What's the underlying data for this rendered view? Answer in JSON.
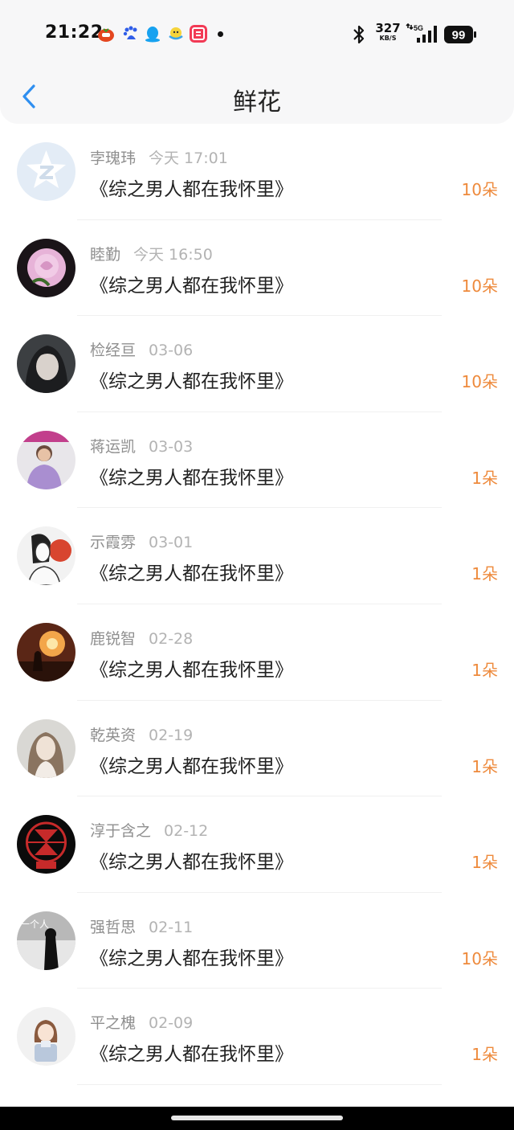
{
  "status_bar": {
    "time": "21:22",
    "net_speed_value": "327",
    "net_speed_unit": "KB/S",
    "network_type": "5G",
    "battery_level": "99",
    "notification_icons": [
      "tomato-app-icon",
      "baidu-app-icon",
      "qq-penguin-icon",
      "chick-app-icon",
      "taobao-app-icon"
    ]
  },
  "header": {
    "title": "鲜花",
    "back_icon": "chevron-left-icon"
  },
  "colors": {
    "accent_blue": "#2f8ff0",
    "amount_orange": "#ee8a3c",
    "meta_gray": "#9a9a9a"
  },
  "list": [
    {
      "name": "孛瑰玮",
      "time": "今天 17:01",
      "book": "《综之男人都在我怀里》",
      "amount": "10朵",
      "avatar": "default-avatar-icon"
    },
    {
      "name": "睦勤",
      "time": "今天 16:50",
      "book": "《综之男人都在我怀里》",
      "amount": "10朵",
      "avatar": "pink-rose-avatar"
    },
    {
      "name": "检经亘",
      "time": "03-06",
      "book": "《综之男人都在我怀里》",
      "amount": "10朵",
      "avatar": "illustrated-girl-avatar"
    },
    {
      "name": "蒋运凯",
      "time": "03-03",
      "book": "《综之男人都在我怀里》",
      "amount": "1朵",
      "avatar": "person-photo-avatar"
    },
    {
      "name": "示霞雰",
      "time": "03-01",
      "book": "《综之男人都在我怀里》",
      "amount": "1朵",
      "avatar": "sketch-avatar"
    },
    {
      "name": "鹿锐智",
      "time": "02-28",
      "book": "《综之男人都在我怀里》",
      "amount": "1朵",
      "avatar": "sunset-avatar"
    },
    {
      "name": "乾英资",
      "time": "02-19",
      "book": "《综之男人都在我怀里》",
      "amount": "1朵",
      "avatar": "portrait-avatar"
    },
    {
      "name": "淳于含之",
      "time": "02-12",
      "book": "《综之男人都在我怀里》",
      "amount": "1朵",
      "avatar": "exo-logo-avatar"
    },
    {
      "name": "强哲思",
      "time": "02-11",
      "book": "《综之男人都在我怀里》",
      "amount": "10朵",
      "avatar": "silhouette-avatar",
      "avatar_text": "一个人"
    },
    {
      "name": "平之槐",
      "time": "02-09",
      "book": "《综之男人都在我怀里》",
      "amount": "1朵",
      "avatar": "cartoon-girl-avatar"
    }
  ]
}
